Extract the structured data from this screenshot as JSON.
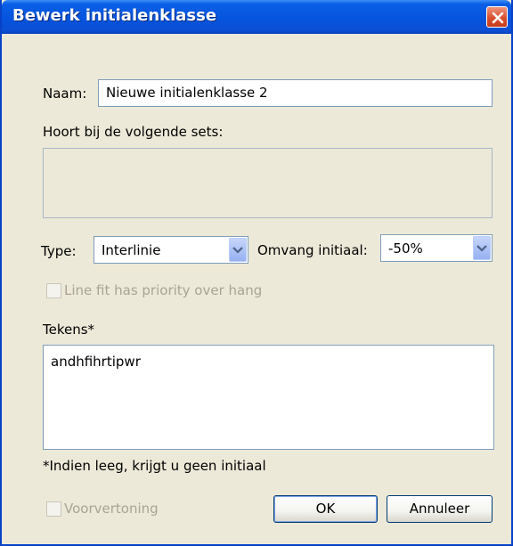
{
  "dialog": {
    "title": "Bewerk initialenklasse"
  },
  "naam": {
    "label": "Naam:",
    "value": "Nieuwe initialenklasse 2"
  },
  "sets": {
    "label": "Hoort bij de volgende sets:"
  },
  "type": {
    "label": "Type:",
    "selected": "Interlinie"
  },
  "omvang": {
    "label": "Omvang initiaal:",
    "selected": "-50%"
  },
  "line_fit": {
    "label": "Line fit has priority over hang",
    "checked": false,
    "enabled": false
  },
  "tekens": {
    "label": "Tekens*",
    "value": "andhfihrtipwr"
  },
  "footnote": "*Indien leeg, krijgt u geen initiaal",
  "preview": {
    "label": "Voorvertoning",
    "checked": false,
    "enabled": false
  },
  "buttons": {
    "ok": "OK",
    "cancel": "Annuleer"
  },
  "icons": {
    "close": "close-icon",
    "dropdown": "chevron-down-icon"
  }
}
